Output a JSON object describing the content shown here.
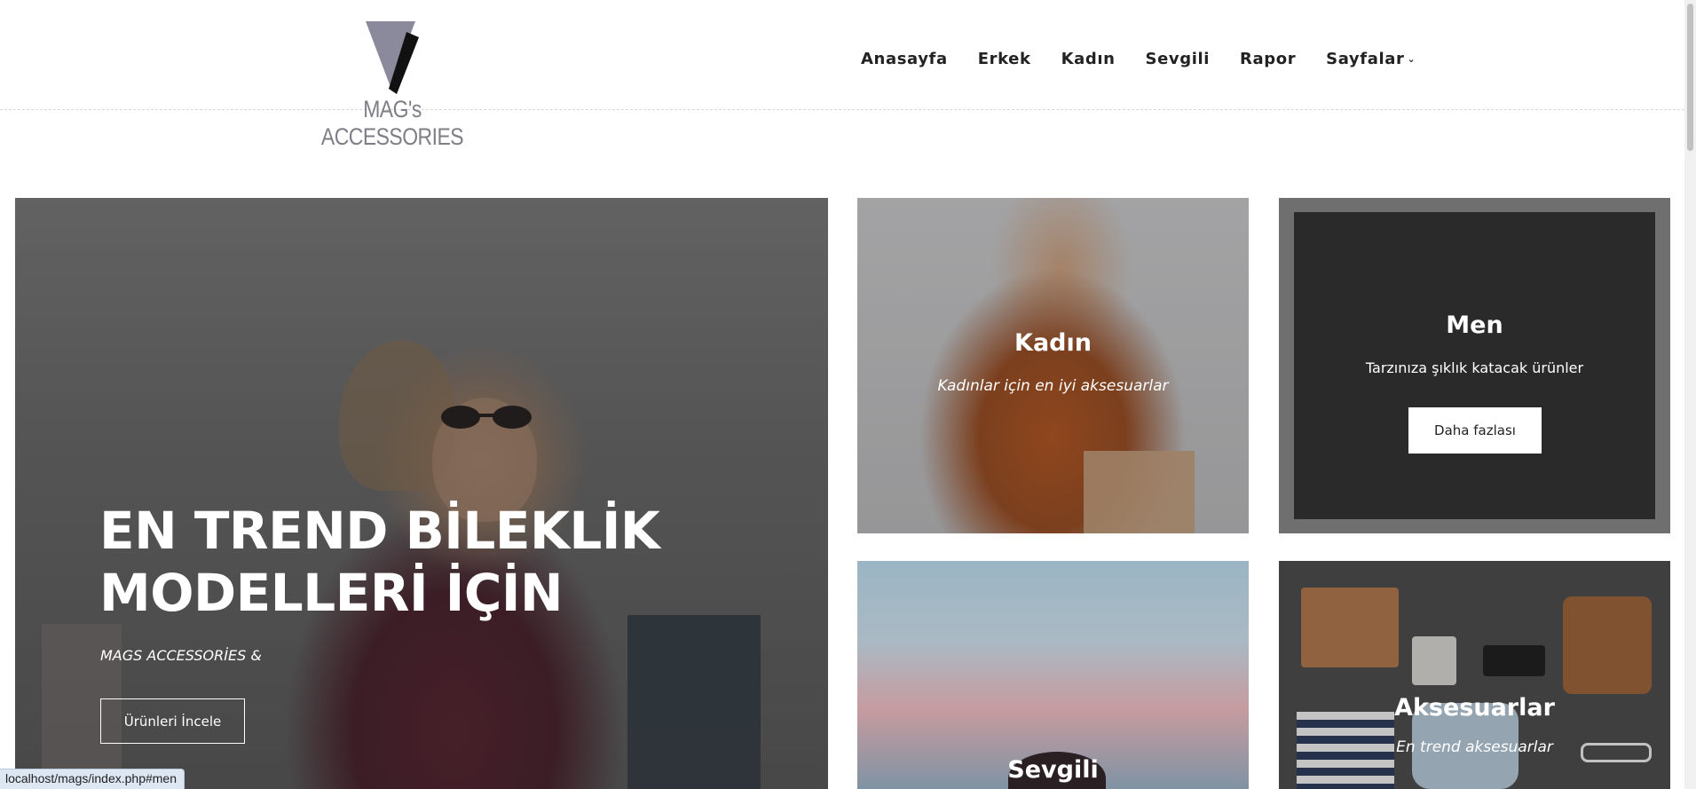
{
  "brand": {
    "logo_text": "MAG's ACCESSORIES"
  },
  "nav": {
    "items": [
      {
        "label": "Anasayfa"
      },
      {
        "label": "Erkek"
      },
      {
        "label": "Kadın"
      },
      {
        "label": "Sevgili"
      },
      {
        "label": "Rapor"
      },
      {
        "label": "Sayfalar"
      }
    ],
    "dropdown_icon": "chevron-down-icon"
  },
  "hero": {
    "title_line1": "EN TREND BİLEKLİK",
    "title_line2": "MODELLERİ İÇİN",
    "subtitle": "MAGS ACCESSORİES &",
    "button_label": "Ürünleri İncele"
  },
  "cards": {
    "kadin": {
      "title": "Kadın",
      "subtitle": "Kadınlar için en iyi aksesuarlar"
    },
    "men": {
      "title": "Men",
      "subtitle": "Tarzınıza şıklık katacak ürünler",
      "button_label": "Daha fazlası"
    },
    "sevgili": {
      "title": "Sevgili"
    },
    "aksesuarlar": {
      "title": "Aksesuarlar",
      "subtitle": "En trend aksesuarlar"
    }
  },
  "statusbar": {
    "url": "localhost/mags/index.php#men"
  },
  "colors": {
    "logo_triangle": "#8b8a9c",
    "logo_stroke": "#111111",
    "nav_text": "#222222",
    "men_panel": "#2a2a2a"
  }
}
